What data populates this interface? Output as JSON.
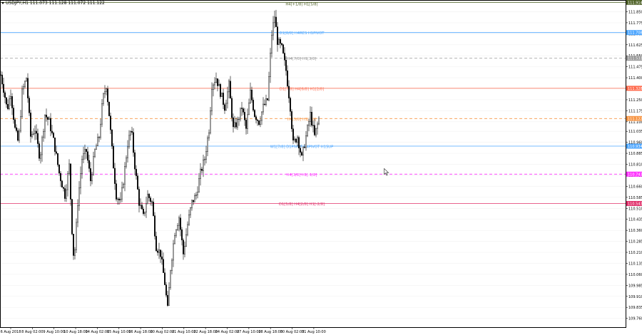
{
  "header": {
    "symbol": "USDJPY,H1",
    "ohlc": "111.073 111.128 111.072 111.122"
  },
  "colors": {
    "background": "#ffffff",
    "candle": "#000000",
    "axis": "#000000",
    "grid": "#f2f2f2"
  },
  "chart_data": {
    "type": "candlestick",
    "symbol": "USDJPY",
    "timeframe": "H1",
    "ylim": [
      109.7,
      111.93
    ],
    "y_ticks": [
      "111.850",
      "111.775",
      "111.700",
      "111.625",
      "111.550",
      "111.475",
      "111.400",
      "111.325",
      "111.250",
      "111.175",
      "111.100",
      "111.035",
      "110.960",
      "110.885",
      "110.810",
      "110.735",
      "110.660",
      "110.585",
      "110.510",
      "110.435",
      "110.360",
      "110.285",
      "110.210",
      "110.135",
      "110.060",
      "109.985",
      "109.910",
      "109.835",
      "109.760"
    ],
    "x_ticks": [
      "6 Aug 2018",
      "8 Aug 02:00",
      "9 Aug 10:00",
      "10 Aug 18:00",
      "14 Aug 02:00",
      "15 Aug 10:00",
      "16 Aug 18:00",
      "20 Aug 02:00",
      "21 Aug 10:00",
      "22 Aug 18:00",
      "24 Aug 02:00",
      "27 Aug 10:00",
      "28 Aug 18:00",
      "30 Aug 02:00",
      "31 Aug 10:00"
    ],
    "current_price": "111.122",
    "series_anchors": [
      {
        "t": 0,
        "v": 111.42
      },
      {
        "t": 5,
        "v": 111.3
      },
      {
        "t": 9,
        "v": 111.18
      },
      {
        "t": 14,
        "v": 111.3
      },
      {
        "t": 20,
        "v": 111.05
      },
      {
        "t": 25,
        "v": 110.95
      },
      {
        "t": 30,
        "v": 111.3
      },
      {
        "t": 36,
        "v": 111.4
      },
      {
        "t": 42,
        "v": 111.0
      },
      {
        "t": 48,
        "v": 111.05
      },
      {
        "t": 55,
        "v": 110.85
      },
      {
        "t": 62,
        "v": 111.15
      },
      {
        "t": 68,
        "v": 111.1
      },
      {
        "t": 75,
        "v": 110.95
      },
      {
        "t": 82,
        "v": 110.75
      },
      {
        "t": 90,
        "v": 110.6
      },
      {
        "t": 96,
        "v": 110.8
      },
      {
        "t": 101,
        "v": 110.25
      },
      {
        "t": 103,
        "v": 110.15
      },
      {
        "t": 108,
        "v": 110.55
      },
      {
        "t": 114,
        "v": 110.85
      },
      {
        "t": 120,
        "v": 110.9
      },
      {
        "t": 126,
        "v": 110.7
      },
      {
        "t": 132,
        "v": 110.9
      },
      {
        "t": 138,
        "v": 111.0
      },
      {
        "t": 143,
        "v": 111.25
      },
      {
        "t": 148,
        "v": 111.35
      },
      {
        "t": 152,
        "v": 111.15
      },
      {
        "t": 157,
        "v": 110.85
      },
      {
        "t": 162,
        "v": 110.6
      },
      {
        "t": 168,
        "v": 110.55
      },
      {
        "t": 172,
        "v": 110.7
      },
      {
        "t": 178,
        "v": 110.95
      },
      {
        "t": 183,
        "v": 111.05
      },
      {
        "t": 188,
        "v": 110.8
      },
      {
        "t": 194,
        "v": 110.55
      },
      {
        "t": 200,
        "v": 110.45
      },
      {
        "t": 206,
        "v": 110.6
      },
      {
        "t": 212,
        "v": 110.55
      },
      {
        "t": 218,
        "v": 110.25
      },
      {
        "t": 224,
        "v": 110.2
      },
      {
        "t": 230,
        "v": 110.0
      },
      {
        "t": 234,
        "v": 109.82
      },
      {
        "t": 238,
        "v": 110.1
      },
      {
        "t": 244,
        "v": 110.35
      },
      {
        "t": 250,
        "v": 110.45
      },
      {
        "t": 256,
        "v": 110.2
      },
      {
        "t": 262,
        "v": 110.4
      },
      {
        "t": 268,
        "v": 110.55
      },
      {
        "t": 274,
        "v": 110.6
      },
      {
        "t": 280,
        "v": 110.75
      },
      {
        "t": 286,
        "v": 110.85
      },
      {
        "t": 292,
        "v": 111.05
      },
      {
        "t": 296,
        "v": 111.35
      },
      {
        "t": 302,
        "v": 111.4
      },
      {
        "t": 308,
        "v": 111.3
      },
      {
        "t": 314,
        "v": 111.2
      },
      {
        "t": 320,
        "v": 111.35
      },
      {
        "t": 326,
        "v": 111.05
      },
      {
        "t": 332,
        "v": 111.1
      },
      {
        "t": 338,
        "v": 111.2
      },
      {
        "t": 344,
        "v": 111.05
      },
      {
        "t": 350,
        "v": 111.3
      },
      {
        "t": 356,
        "v": 111.15
      },
      {
        "t": 362,
        "v": 111.1
      },
      {
        "t": 368,
        "v": 111.2
      },
      {
        "t": 374,
        "v": 111.25
      },
      {
        "t": 380,
        "v": 111.7
      },
      {
        "t": 384,
        "v": 111.82
      },
      {
        "t": 388,
        "v": 111.65
      },
      {
        "t": 394,
        "v": 111.6
      },
      {
        "t": 400,
        "v": 111.45
      },
      {
        "t": 406,
        "v": 111.2
      },
      {
        "t": 410,
        "v": 110.95
      },
      {
        "t": 416,
        "v": 111.0
      },
      {
        "t": 422,
        "v": 110.85
      },
      {
        "t": 428,
        "v": 111.0
      },
      {
        "t": 434,
        "v": 111.15
      },
      {
        "t": 440,
        "v": 111.0
      },
      {
        "t": 446,
        "v": 111.12
      }
    ],
    "levels": [
      {
        "label": "",
        "price": "111.914",
        "color": "#4f6228",
        "style": "solid"
      },
      {
        "label": "H4[+1/8] H1[5/8]",
        "price": "",
        "color": "#4f6228",
        "style": "none"
      },
      {
        "label": "D1[8/8] H4RES H1PIVOT",
        "price": "111.708",
        "color": "#4da6ff",
        "style": "solid"
      },
      {
        "label": "H4[7/8] H1[3/8]",
        "price": "111.533",
        "color": "#999999",
        "style": "dash"
      },
      {
        "label": "D1[7/8] H4[6/8] H1[2/8]",
        "price": "111.328",
        "color": "#ff6a4d",
        "style": "solid"
      },
      {
        "label": "H4[5/8] H1[1/8]",
        "price": "111.122",
        "color": "#f79646",
        "style": "dash"
      },
      {
        "label": "W1[7/8] D1PIVOT H4PIVOT H1SUP",
        "price": "110.934",
        "color": "#4da6ff",
        "style": "solid"
      },
      {
        "label": "H4[3/8] H1[-1/8]",
        "price": "110.743",
        "color": "#ff33ff",
        "style": "dash"
      },
      {
        "label": "D1[5/8] H4[2/8] H1[-2/8]",
        "price": "110.543",
        "color": "#e0306a",
        "style": "solid"
      }
    ]
  }
}
